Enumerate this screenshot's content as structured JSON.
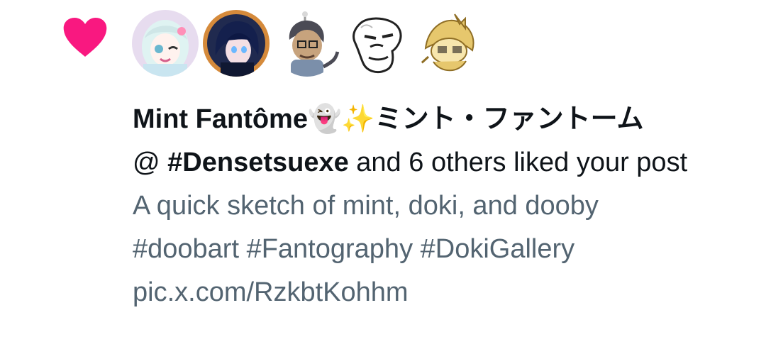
{
  "notification": {
    "icon": "heart-icon",
    "accent_color": "#f91880",
    "avatars": [
      {
        "name": "avatar-mint",
        "colors": {
          "bg": "#e7dcef",
          "hair": "#dff3f2",
          "accent": "#ff8fb8"
        }
      },
      {
        "name": "avatar-blue-hair",
        "colors": {
          "bg": "#d58a3b",
          "hair": "#1d2a63",
          "accent": "#6bb8ff"
        }
      },
      {
        "name": "avatar-monkey",
        "colors": {
          "bg": "#ffffff",
          "hair": "#4b4b55",
          "accent": "#7b8faa"
        }
      },
      {
        "name": "avatar-sketch-face",
        "colors": {
          "bg": "#ffffff",
          "hair": "#222222",
          "accent": "#bbbbbb"
        }
      },
      {
        "name": "avatar-yellow-character",
        "colors": {
          "bg": "#ffffff",
          "hair": "#e6c76d",
          "accent": "#8f6e25"
        }
      }
    ],
    "display_name": "Mint Fantôme",
    "display_name_emoji_1": "👻",
    "display_name_emoji_2": "✨",
    "display_name_suffix": "ミント・ファントーム",
    "summary_prefix": "@ ",
    "summary_handle": "#Densetsuexe",
    "summary_rest": " and 6 others liked your post",
    "post_lines": [
      "A quick sketch  of mint, doki, and dooby",
      "#doobart #Fantography #DokiGallery",
      "pic.x.com/RzkbtKohhm"
    ],
    "text_color": "#0f1419",
    "muted_color": "#536471"
  }
}
